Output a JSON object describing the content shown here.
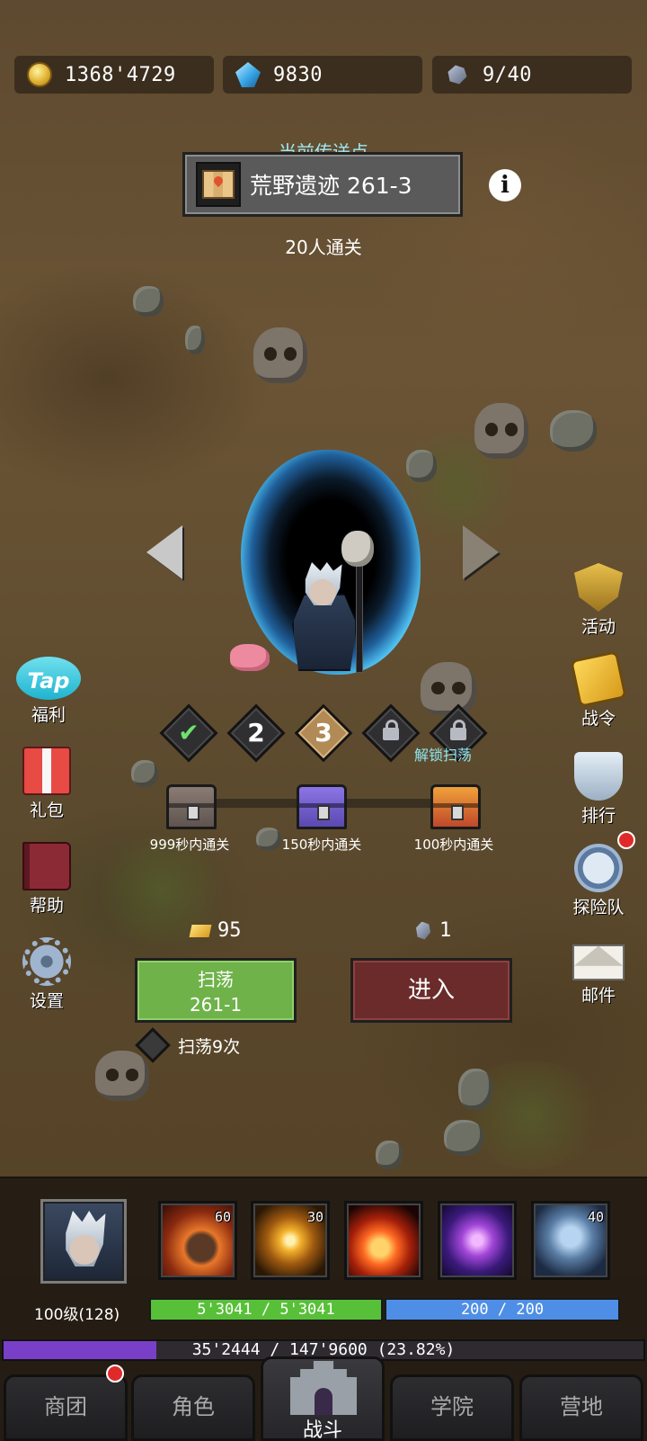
{
  "resources": {
    "gold": "1368'4729",
    "gems": "9830",
    "stamina": "9/40"
  },
  "teleport": {
    "title": "当前传送点",
    "location": "荒野遗迹  261-3",
    "cleared": "20人通关"
  },
  "difficulty": {
    "levels": [
      "2",
      "3"
    ],
    "unlock_label": "解锁扫荡"
  },
  "chests": [
    {
      "label": "999秒内通关"
    },
    {
      "label": "150秒内通关"
    },
    {
      "label": "100秒内通关"
    }
  ],
  "costs": {
    "sweep_cost": "95",
    "enter_cost": "1"
  },
  "buttons": {
    "sweep_line1": "扫荡",
    "sweep_line2": "261-1",
    "enter": "进入",
    "sweep_times": "扫荡9次"
  },
  "left_menu": {
    "tap_logo": "Tap",
    "welfare": "福利",
    "gift": "礼包",
    "help": "帮助",
    "settings": "设置"
  },
  "right_menu": {
    "events": "活动",
    "battle_pass": "战令",
    "ranking": "排行",
    "expedition": "探险队",
    "mail": "邮件"
  },
  "skills": [
    {
      "icon": "meteor-skill-icon",
      "badge": "60"
    },
    {
      "icon": "starburst-skill-icon",
      "badge": "30"
    },
    {
      "icon": "fireball-skill-icon",
      "badge": ""
    },
    {
      "icon": "vortex-skill-icon",
      "badge": ""
    },
    {
      "icon": "twin-spirit-skill-icon",
      "badge": "40"
    }
  ],
  "stats": {
    "level": "100级(128)",
    "hp": "5'3041 / 5'3041",
    "mp": "200 / 200",
    "xp": "35'2444 / 147'9600 (23.82%)",
    "xp_fraction": 0.2382
  },
  "nav": {
    "guild": "商团",
    "character": "角色",
    "battle": "战斗",
    "academy": "学院",
    "camp": "营地"
  },
  "colors": {
    "hp": "#58c038",
    "mp": "#4f8ee6",
    "xp": "#7a3fc8",
    "sweep_button": "#6fb24a",
    "enter_button": "#6b2b2b"
  }
}
